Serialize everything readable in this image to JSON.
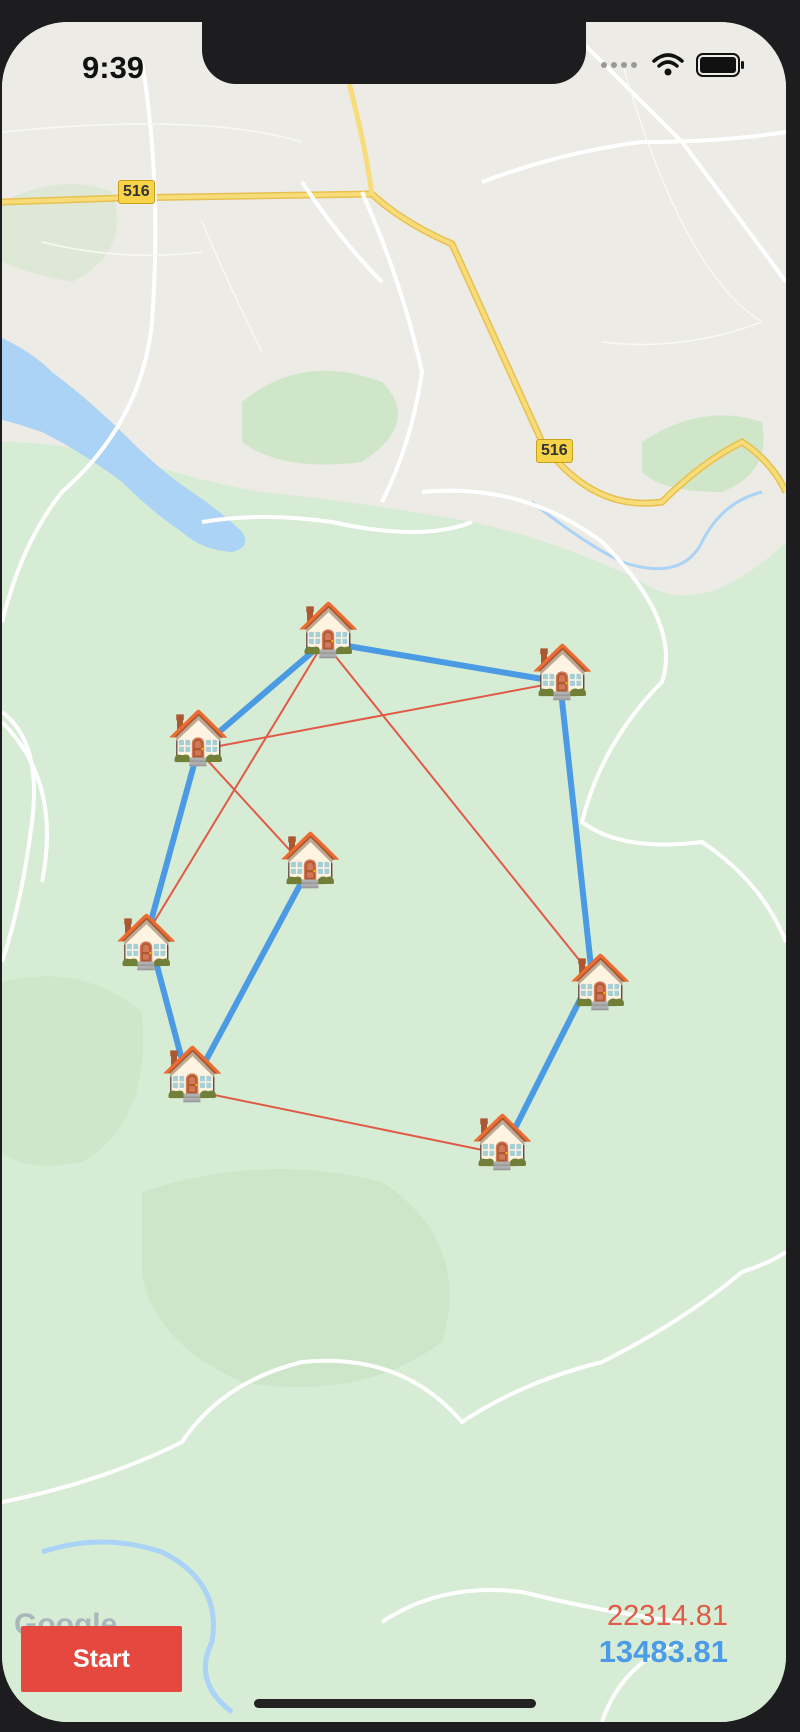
{
  "status_bar": {
    "time": "9:39"
  },
  "map": {
    "route_badges": [
      "516",
      "516"
    ],
    "attribution": "Google",
    "houses": [
      {
        "id": "house-1",
        "emoji": "🏠"
      },
      {
        "id": "house-2",
        "emoji": "🏠"
      },
      {
        "id": "house-3",
        "emoji": "🏠"
      },
      {
        "id": "house-4",
        "emoji": "🏠"
      },
      {
        "id": "house-5",
        "emoji": "🏠"
      },
      {
        "id": "house-6",
        "emoji": "🏠"
      },
      {
        "id": "house-7",
        "emoji": "🏠"
      },
      {
        "id": "house-8",
        "emoji": "🏠"
      }
    ],
    "colors": {
      "land": "#d6ecd4",
      "urban": "#ecebe6",
      "water": "#aad3f5",
      "highway": "#f5d66b",
      "road": "#ffffff",
      "route_red": "#e05a46",
      "route_blue": "#4a9be3"
    }
  },
  "controls": {
    "start_label": "Start"
  },
  "scores": {
    "red_distance": "22314.81",
    "blue_distance": "13483.81"
  }
}
